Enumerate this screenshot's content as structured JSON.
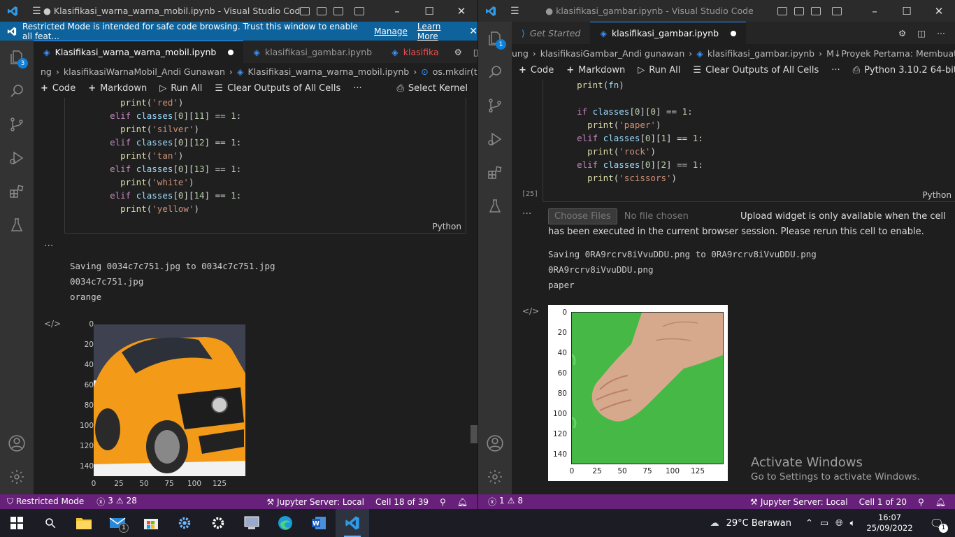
{
  "left": {
    "title": "● Klasifikasi_warna_warna_mobil.ipynb - Visual Studio Code",
    "banner": {
      "text": "Restricted Mode is intended for safe code browsing. Trust this window to enable all feat...",
      "manage": "Manage",
      "learn_more": "Learn More"
    },
    "explorer_badge": "3",
    "tabs": [
      {
        "label": "Klasifikasi_warna_warna_mobil.ipynb",
        "active": true
      },
      {
        "label": "klasifikasi_gambar.ipynb",
        "active": false
      },
      {
        "label": "klasifika",
        "active": false
      }
    ],
    "breadcrumb": [
      "ng",
      "klasifikasiWarnaMobil_Andi Gunawan",
      "Klasifikasi_warna_warna_mobil.ipynb",
      "os.mkdir(train_dir)"
    ],
    "toolbar": {
      "code": "Code",
      "markdown": "Markdown",
      "run_all": "Run All",
      "clear": "Clear Outputs of All Cells",
      "more": "···",
      "kernel": "Select Kernel"
    },
    "code_lines": [
      {
        "indent": "    ",
        "parts": [
          [
            "fn",
            "print"
          ],
          [
            "p",
            "("
          ],
          [
            "str",
            "'red'"
          ],
          [
            "p",
            ")"
          ]
        ]
      },
      {
        "indent": "  ",
        "parts": [
          [
            "kw",
            "elif "
          ],
          [
            "var",
            "classes"
          ],
          [
            "p",
            "["
          ],
          [
            "num",
            "0"
          ],
          [
            "p",
            "]["
          ],
          [
            "num",
            "11"
          ],
          [
            "p",
            "] == "
          ],
          [
            "num",
            "1"
          ],
          [
            "p",
            ":"
          ]
        ]
      },
      {
        "indent": "    ",
        "parts": [
          [
            "fn",
            "print"
          ],
          [
            "p",
            "("
          ],
          [
            "str",
            "'silver'"
          ],
          [
            "p",
            ")"
          ]
        ]
      },
      {
        "indent": "  ",
        "parts": [
          [
            "kw",
            "elif "
          ],
          [
            "var",
            "classes"
          ],
          [
            "p",
            "["
          ],
          [
            "num",
            "0"
          ],
          [
            "p",
            "]["
          ],
          [
            "num",
            "12"
          ],
          [
            "p",
            "] == "
          ],
          [
            "num",
            "1"
          ],
          [
            "p",
            ":"
          ]
        ]
      },
      {
        "indent": "    ",
        "parts": [
          [
            "fn",
            "print"
          ],
          [
            "p",
            "("
          ],
          [
            "str",
            "'tan'"
          ],
          [
            "p",
            ")"
          ]
        ]
      },
      {
        "indent": "  ",
        "parts": [
          [
            "kw",
            "elif "
          ],
          [
            "var",
            "classes"
          ],
          [
            "p",
            "["
          ],
          [
            "num",
            "0"
          ],
          [
            "p",
            "]["
          ],
          [
            "num",
            "13"
          ],
          [
            "p",
            "] == "
          ],
          [
            "num",
            "1"
          ],
          [
            "p",
            ":"
          ]
        ]
      },
      {
        "indent": "    ",
        "parts": [
          [
            "fn",
            "print"
          ],
          [
            "p",
            "("
          ],
          [
            "str",
            "'white'"
          ],
          [
            "p",
            ")"
          ]
        ]
      },
      {
        "indent": "  ",
        "parts": [
          [
            "kw",
            "elif "
          ],
          [
            "var",
            "classes"
          ],
          [
            "p",
            "["
          ],
          [
            "num",
            "0"
          ],
          [
            "p",
            "]["
          ],
          [
            "num",
            "14"
          ],
          [
            "p",
            "] == "
          ],
          [
            "num",
            "1"
          ],
          [
            "p",
            ":"
          ]
        ]
      },
      {
        "indent": "    ",
        "parts": [
          [
            "fn",
            "print"
          ],
          [
            "p",
            "("
          ],
          [
            "str",
            "'yellow'"
          ],
          [
            "p",
            ")"
          ]
        ]
      }
    ],
    "lang": "Python",
    "output_lines": [
      "Saving 0034c7c751.jpg to 0034c7c751.jpg",
      "0034c7c751.jpg",
      "orange"
    ],
    "plot": {
      "yticks": [
        "0",
        "20",
        "40",
        "60",
        "80",
        "100",
        "120",
        "140"
      ],
      "xticks": [
        "0",
        "25",
        "50",
        "75",
        "100",
        "125"
      ]
    },
    "status": {
      "restricted": "Restricted Mode",
      "errors": "3",
      "warnings": "28",
      "jupyter": "Jupyter Server: Local",
      "cell": "Cell 18 of 39"
    }
  },
  "right": {
    "title": "● klasifikasi_gambar.ipynb - Visual Studio Code",
    "explorer_badge": "1",
    "tabs": [
      {
        "label": "Get Started",
        "active": false
      },
      {
        "label": "klasifikasi_gambar.ipynb",
        "active": true
      }
    ],
    "breadcrumb": [
      "ung",
      "klasifikasiGambar_Andi gunawan",
      "klasifikasi_gambar.ipynb",
      "M↓Proyek Pertama: Membuat Model N"
    ],
    "toolbar": {
      "code": "Code",
      "markdown": "Markdown",
      "run_all": "Run All",
      "clear": "Clear Outputs of All Cells",
      "more": "···",
      "kernel": "Python 3.10.2 64-bit"
    },
    "code_lines": [
      {
        "indent": "  ",
        "parts": [
          [
            "fn",
            "print"
          ],
          [
            "p",
            "("
          ],
          [
            "var",
            "fn"
          ],
          [
            "p",
            ")"
          ]
        ]
      },
      {
        "indent": "",
        "parts": []
      },
      {
        "indent": "  ",
        "parts": [
          [
            "kw",
            "if "
          ],
          [
            "var",
            "classes"
          ],
          [
            "p",
            "["
          ],
          [
            "num",
            "0"
          ],
          [
            "p",
            "]["
          ],
          [
            "num",
            "0"
          ],
          [
            "p",
            "] == "
          ],
          [
            "num",
            "1"
          ],
          [
            "p",
            ":"
          ]
        ]
      },
      {
        "indent": "    ",
        "parts": [
          [
            "fn",
            "print"
          ],
          [
            "p",
            "("
          ],
          [
            "str",
            "'paper'"
          ],
          [
            "p",
            ")"
          ]
        ]
      },
      {
        "indent": "  ",
        "parts": [
          [
            "kw",
            "elif "
          ],
          [
            "var",
            "classes"
          ],
          [
            "p",
            "["
          ],
          [
            "num",
            "0"
          ],
          [
            "p",
            "]["
          ],
          [
            "num",
            "1"
          ],
          [
            "p",
            "] == "
          ],
          [
            "num",
            "1"
          ],
          [
            "p",
            ":"
          ]
        ]
      },
      {
        "indent": "    ",
        "parts": [
          [
            "fn",
            "print"
          ],
          [
            "p",
            "("
          ],
          [
            "str",
            "'rock'"
          ],
          [
            "p",
            ")"
          ]
        ]
      },
      {
        "indent": "  ",
        "parts": [
          [
            "kw",
            "elif "
          ],
          [
            "var",
            "classes"
          ],
          [
            "p",
            "["
          ],
          [
            "num",
            "0"
          ],
          [
            "p",
            "]["
          ],
          [
            "num",
            "2"
          ],
          [
            "p",
            "] == "
          ],
          [
            "num",
            "1"
          ],
          [
            "p",
            ":"
          ]
        ]
      },
      {
        "indent": "    ",
        "parts": [
          [
            "fn",
            "print"
          ],
          [
            "p",
            "("
          ],
          [
            "str",
            "'scissors'"
          ],
          [
            "p",
            ")"
          ]
        ]
      }
    ],
    "exec_count": "[25]",
    "lang": "Python",
    "choose_files": "Choose Files",
    "no_file": "No file chosen",
    "upload_msg": "Upload widget is only available when the cell has been executed in the current browser session. Please rerun this cell to enable.",
    "output_lines": [
      "Saving 0RA9rcrv8iVvuDDU.png to 0RA9rcrv8iVvuDDU.png",
      "0RA9rcrv8iVvuDDU.png",
      "paper"
    ],
    "plot": {
      "yticks": [
        "0",
        "20",
        "40",
        "60",
        "80",
        "100",
        "120",
        "140"
      ],
      "xticks": [
        "0",
        "25",
        "50",
        "75",
        "100",
        "125"
      ]
    },
    "watermark": {
      "title": "Activate Windows",
      "sub": "Go to Settings to activate Windows."
    },
    "status": {
      "errors": "1",
      "warnings": "8",
      "jupyter": "Jupyter Server: Local",
      "cell": "Cell 1 of 20"
    }
  },
  "taskbar": {
    "weather": "29°C  Berawan",
    "time": "16:07",
    "date": "25/09/2022",
    "mail_badge": "1",
    "notif_badge": "1"
  }
}
